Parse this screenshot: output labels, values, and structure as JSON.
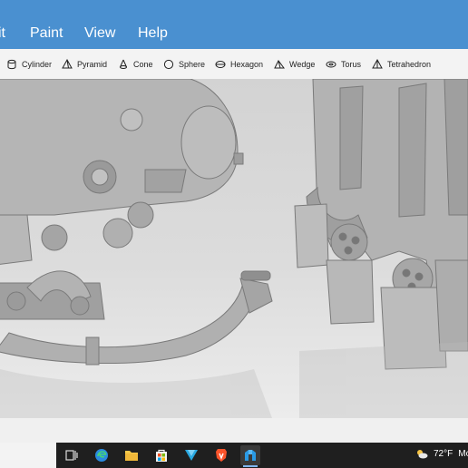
{
  "menu": {
    "items": [
      {
        "label": "it",
        "name": "menu-edit"
      },
      {
        "label": "Paint",
        "name": "menu-paint"
      },
      {
        "label": "View",
        "name": "menu-view"
      },
      {
        "label": "Help",
        "name": "menu-help"
      }
    ]
  },
  "toolbar": {
    "cylinder": "Cylinder",
    "pyramid": "Pyramid",
    "cone": "Cone",
    "sphere": "Sphere",
    "hexagon": "Hexagon",
    "wedge": "Wedge",
    "torus": "Torus",
    "tetrahedron": "Tetrahedron"
  },
  "taskbar": {
    "weather_temp": "72°F",
    "weather_text": "Mo",
    "icons": [
      "task-view-icon",
      "edge-icon",
      "file-explorer-icon",
      "store-icon",
      "app-icon",
      "brave-icon",
      "3d-builder-icon"
    ]
  },
  "colors": {
    "menubar": "#4a90d0",
    "toolbar": "#f3f3f3",
    "taskbar": "#1f1f1f"
  }
}
